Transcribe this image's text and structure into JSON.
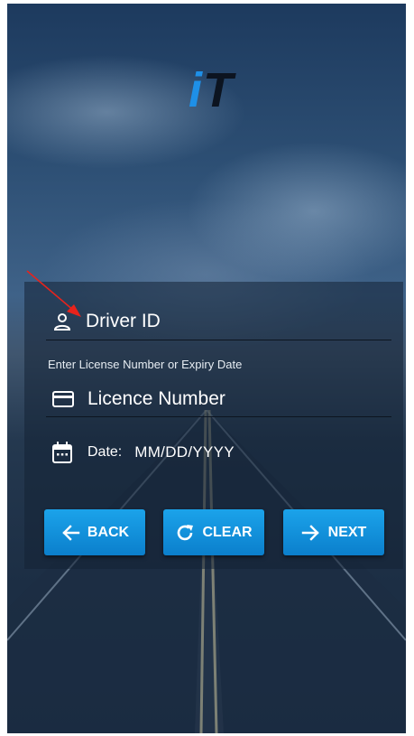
{
  "logo": {
    "text_i": "i",
    "text_t": "T"
  },
  "form": {
    "driver_id_placeholder": "Driver ID",
    "hint": "Enter License Number or Expiry Date",
    "licence_placeholder": "Licence Number",
    "date_label": "Date:",
    "date_placeholder": "MM/DD/YYYY"
  },
  "buttons": {
    "back": "BACK",
    "clear": "CLEAR",
    "next": "NEXT"
  },
  "icons": {
    "driver": "person-icon",
    "licence": "card-icon",
    "date": "calendar-icon",
    "back": "arrow-left-icon",
    "clear": "refresh-icon",
    "next": "arrow-right-icon"
  },
  "colors": {
    "button": "#1197e0",
    "logo_i": "#1e90e8",
    "logo_t": "#0c1420",
    "annotation_arrow": "#e8231c"
  }
}
